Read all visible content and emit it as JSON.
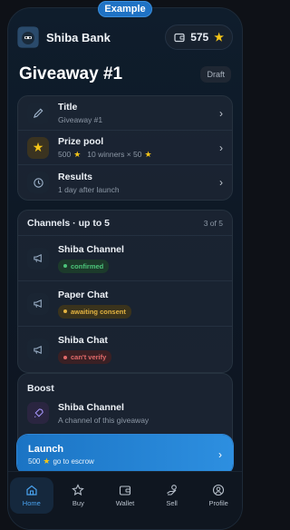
{
  "example_label": "Example",
  "app": {
    "title": "Shiba Bank",
    "balance": "575"
  },
  "page": {
    "title": "Giveaway #1",
    "status": "Draft"
  },
  "settings": [
    {
      "title": "Title",
      "sub": "Giveaway #1",
      "icon": "pencil-icon"
    },
    {
      "title": "Prize pool",
      "sub_amount": "500",
      "sub_detail": "10 winners × 50",
      "icon": "star-icon"
    },
    {
      "title": "Results",
      "sub": "1 day after launch",
      "icon": "clock-icon"
    }
  ],
  "channels": {
    "header": "Channels · up to 5",
    "count": "3 of 5",
    "items": [
      {
        "name": "Shiba Channel",
        "status": "confirmed",
        "color": "#4cc47a"
      },
      {
        "name": "Paper Chat",
        "status": "awaiting consent",
        "color": "#e3b341"
      },
      {
        "name": "Shiba Chat",
        "status": "can't verify",
        "color": "#e26a6a"
      }
    ]
  },
  "boost": {
    "header": "Boost",
    "name": "Shiba Channel",
    "sub": "A channel of this giveaway"
  },
  "launch": {
    "label": "Launch",
    "amount": "500",
    "suffix": "go to escrow"
  },
  "tabs": [
    {
      "label": "Home",
      "icon": "home-icon",
      "active": true
    },
    {
      "label": "Buy",
      "icon": "star-outline-icon"
    },
    {
      "label": "Wallet",
      "icon": "wallet-icon"
    },
    {
      "label": "Sell",
      "icon": "hand-coin-icon"
    },
    {
      "label": "Profile",
      "icon": "profile-icon"
    }
  ],
  "colors": {
    "accent": "#2d8fe0",
    "star": "#f5c518"
  }
}
